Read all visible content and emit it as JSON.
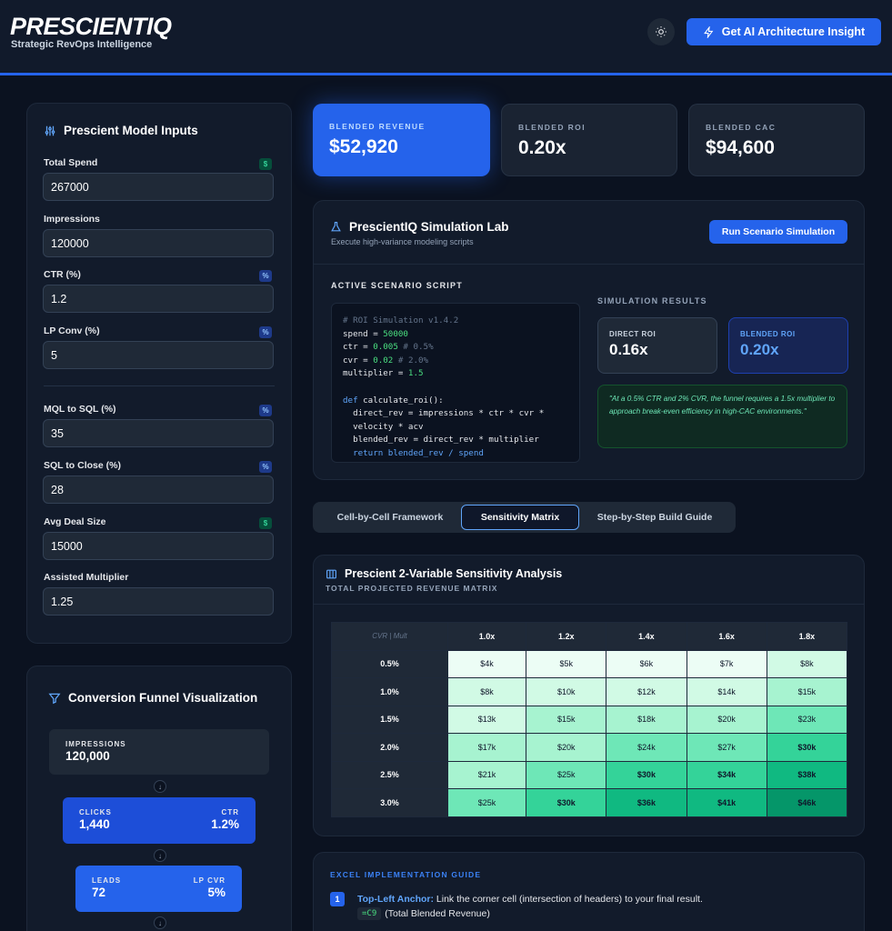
{
  "header": {
    "brand": "PRESCIENTIQ",
    "tagline": "Strategic RevOps Intelligence",
    "insight_button": "Get AI Architecture Insight"
  },
  "inputs": {
    "title": "Prescient Model Inputs",
    "fields": [
      {
        "label": "Total Spend",
        "value": "267000",
        "badge": "$"
      },
      {
        "label": "Impressions",
        "value": "120000",
        "badge": ""
      },
      {
        "label": "CTR (%)",
        "value": "1.2",
        "badge": "%"
      },
      {
        "label": "LP Conv (%)",
        "value": "5",
        "badge": "%"
      },
      {
        "label": "MQL to SQL (%)",
        "value": "35",
        "badge": "%"
      },
      {
        "label": "SQL to Close (%)",
        "value": "28",
        "badge": "%"
      },
      {
        "label": "Avg Deal Size",
        "value": "15000",
        "badge": "$"
      },
      {
        "label": "Assisted Multiplier",
        "value": "1.25",
        "badge": ""
      }
    ]
  },
  "kpis": [
    {
      "label": "BLENDED REVENUE",
      "value": "$52,920"
    },
    {
      "label": "BLENDED ROI",
      "value": "0.20x"
    },
    {
      "label": "BLENDED CAC",
      "value": "$94,600"
    }
  ],
  "lab": {
    "title": "PrescientIQ Simulation Lab",
    "subtitle": "Execute high-variance modeling scripts",
    "run_button": "Run Scenario Simulation",
    "script_heading": "ACTIVE SCENARIO SCRIPT",
    "results_heading": "SIMULATION RESULTS",
    "code": {
      "l1": "# ROI Simulation v1.4.2",
      "l2a": "spend = ",
      "l2b": "50000",
      "l3a": "ctr = ",
      "l3b": "0.005",
      "l3c": " # 0.5%",
      "l4a": "cvr = ",
      "l4b": "0.02",
      "l4c": " # 2.0%",
      "l5a": "multiplier = ",
      "l5b": "1.5",
      "l6a": "def",
      "l6b": " calculate_roi():",
      "l7": "  direct_rev = impressions * ctr * cvr *",
      "l8": "  velocity * acv",
      "l9": "  blended_rev = direct_rev * multiplier",
      "l10": "  return blended_rev / spend"
    },
    "direct_label": "DIRECT ROI",
    "direct_value": "0.16x",
    "blended_label": "BLENDED ROI",
    "blended_value": "0.20x",
    "quote": "\"At a 0.5% CTR and 2% CVR, the funnel requires a 1.5x multiplier to approach break-even efficiency in high-CAC environments.\""
  },
  "tabs": [
    {
      "label": "Cell-by-Cell Framework",
      "active": false
    },
    {
      "label": "Sensitivity Matrix",
      "active": true
    },
    {
      "label": "Step-by-Step Build Guide",
      "active": false
    }
  ],
  "matrix": {
    "title": "Prescient 2-Variable Sensitivity Analysis",
    "subtitle": "TOTAL PROJECTED REVENUE MATRIX",
    "corner": "CVR | Mult",
    "cols": [
      "1.0x",
      "1.2x",
      "1.4x",
      "1.6x",
      "1.8x"
    ],
    "rows": [
      {
        "label": "0.5%",
        "cells": [
          "$4k",
          "$5k",
          "$6k",
          "$7k",
          "$8k"
        ]
      },
      {
        "label": "1.0%",
        "cells": [
          "$8k",
          "$10k",
          "$12k",
          "$14k",
          "$15k"
        ]
      },
      {
        "label": "1.5%",
        "cells": [
          "$13k",
          "$15k",
          "$18k",
          "$20k",
          "$23k"
        ]
      },
      {
        "label": "2.0%",
        "cells": [
          "$17k",
          "$20k",
          "$24k",
          "$27k",
          "$30k"
        ]
      },
      {
        "label": "2.5%",
        "cells": [
          "$21k",
          "$25k",
          "$30k",
          "$34k",
          "$38k"
        ]
      },
      {
        "label": "3.0%",
        "cells": [
          "$25k",
          "$30k",
          "$36k",
          "$41k",
          "$46k"
        ]
      }
    ]
  },
  "guide": {
    "heading": "EXCEL IMPLEMENTATION GUIDE",
    "step_num": "1",
    "step_title": "Top-Left Anchor:",
    "step_text": " Link the corner cell (intersection of headers) to your final result.",
    "step_code": "=C9",
    "step_note": "(Total Blended Revenue)"
  },
  "funnel": {
    "title": "Conversion Funnel Visualization",
    "impr_label": "IMPRESSIONS",
    "impr_value": "120,000",
    "clicks_label": "CLICKS",
    "clicks_value": "1,440",
    "ctr_label": "CTR",
    "ctr_value": "1.2%",
    "leads_label": "LEADS",
    "leads_value": "72",
    "lpcvr_label": "LP CVR",
    "lpcvr_value": "5%"
  },
  "colors": {
    "accent": "#2563eb",
    "heat": [
      "#ecfdf5",
      "#d1fae5",
      "#a7f3d0",
      "#6ee7b7",
      "#34d399",
      "#10b981",
      "#059669"
    ]
  }
}
